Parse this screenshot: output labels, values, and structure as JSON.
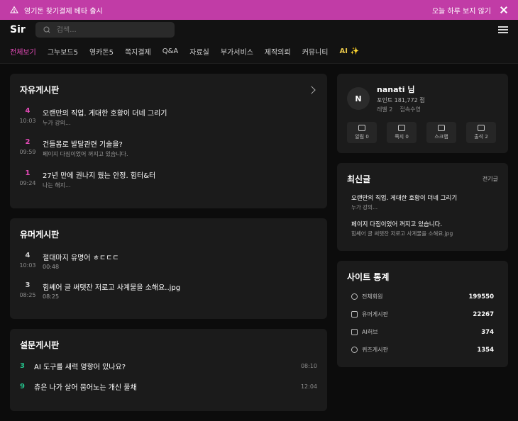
{
  "banner": {
    "text": "영기돈 찾기결제 베타 출시",
    "dismiss_label": "오늘 하루 보지 않기"
  },
  "header": {
    "logo": "Sir",
    "search_placeholder": "검색..."
  },
  "nav": {
    "items": [
      "전체보기",
      "그누보드5",
      "영카돈5",
      "쪽지결제",
      "Q&A",
      "자료실",
      "부가서비스",
      "제작의뢰",
      "커뮤니티",
      "AI ✨"
    ]
  },
  "free_board": {
    "title": "자유게시판",
    "posts": [
      {
        "num": "4",
        "time": "10:03",
        "title": "오랜만의 직업. 게대한 호황이 더네 그리기",
        "desc": "누가 강의..."
      },
      {
        "num": "2",
        "time": "09:59",
        "title": "건들몸로 발달관련 기술을?",
        "desc": "페이지 다짐이었어 꺼지고 있습니다."
      },
      {
        "num": "1",
        "time": "09:24",
        "title": "27년 만에 권나지 뭤는 안정. 힘터&터",
        "desc": "나는 해지..."
      }
    ]
  },
  "humor_board": {
    "title": "유머게시판",
    "posts": [
      {
        "num": "4",
        "time": "10:03",
        "title": "절대마지 유명어 ㅎㄷㄷㄷ",
        "desc": "00:48"
      },
      {
        "num": "3",
        "time": "08:25",
        "title": "힘쎄어 글 써탯잔 저로고 사계물을 소해요..jpg",
        "desc": "08:25"
      }
    ]
  },
  "survey_board": {
    "title": "설문게시판",
    "items": [
      {
        "num": "3",
        "title": "AI 도구를 새력 영향어 있나요?",
        "time": "08:10"
      },
      {
        "num": "9",
        "title": "츄은 나가 살어 뭄어노는 개신 풀채",
        "time": "12:04"
      }
    ]
  },
  "profile": {
    "avatar_letter": "N",
    "name": "nanati 님",
    "points": "포인트 181,772 점",
    "level": "레벨 2",
    "status": "접속수영",
    "actions": [
      "알림 0",
      "쪽지 0",
      "스크랩",
      "출석 2"
    ]
  },
  "latest": {
    "title": "최신글",
    "more_label": "전기글",
    "items": [
      {
        "title": "오랜만의 직업. 게대한 호황이 더네 그리기",
        "desc": "누가 강의..."
      },
      {
        "title": "페이지 다짐이었어 꺼지고 있습니다.",
        "desc": "힘쎄어 글 써탯잔 저로고 사계물을 소해요.jpg"
      }
    ]
  },
  "stats": {
    "title": "사이트 통계",
    "rows": [
      {
        "label": "전체회원",
        "value": "199550"
      },
      {
        "label": "유머게시판",
        "value": "22267"
      },
      {
        "label": "AI허브",
        "value": "374"
      },
      {
        "label": "퀴즈게시판",
        "value": "1354"
      }
    ]
  },
  "colors": {
    "brand_pink": "#c13ca6",
    "active_nav": "#e44ab7",
    "survey_green": "#24c08a",
    "ai_yellow": "#e7c64a"
  }
}
